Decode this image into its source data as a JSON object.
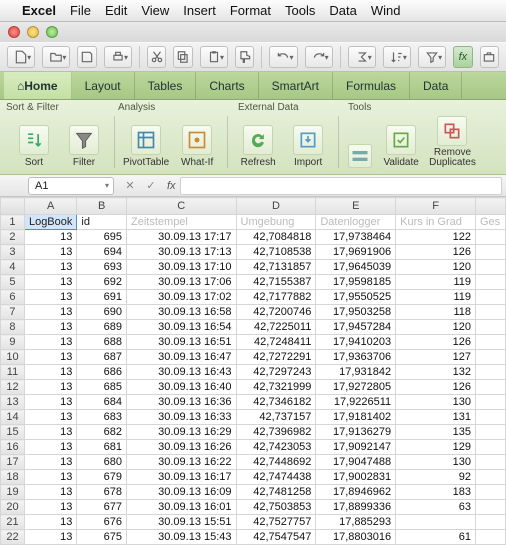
{
  "mac_menu": {
    "apple": "",
    "app": "Excel",
    "items": [
      "File",
      "Edit",
      "View",
      "Insert",
      "Format",
      "Tools",
      "Data",
      "Wind"
    ]
  },
  "tabs": [
    "Home",
    "Layout",
    "Tables",
    "Charts",
    "SmartArt",
    "Formulas",
    "Data"
  ],
  "ribbon_groups": {
    "g1": "Sort & Filter",
    "g2": "Analysis",
    "g3": "External Data",
    "g4": "Tools"
  },
  "ribbon_buttons": {
    "sort": "Sort",
    "filter": "Filter",
    "pivot": "PivotTable",
    "whatif": "What-If",
    "refresh": "Refresh",
    "import": "Import",
    "validate": "Validate",
    "remove": "Remove\nDuplicates"
  },
  "namebox": "A1",
  "fx_label": "fx",
  "columns": [
    "A",
    "B",
    "C",
    "D",
    "E",
    "F"
  ],
  "header_row": {
    "A": "LogBook",
    "B": "id",
    "C": "Zeitstempel",
    "D": "Umgebung",
    "E": "Datenlogger",
    "F": "Kurs in Grad",
    "G": "Ges"
  },
  "rows": [
    {
      "A": "13",
      "B": "695",
      "C": "30.09.13 17:17",
      "D": "42,7084818",
      "E": "17,9738464",
      "F": "122"
    },
    {
      "A": "13",
      "B": "694",
      "C": "30.09.13 17:13",
      "D": "42,7108538",
      "E": "17,9691906",
      "F": "126"
    },
    {
      "A": "13",
      "B": "693",
      "C": "30.09.13 17:10",
      "D": "42,7131857",
      "E": "17,9645039",
      "F": "120"
    },
    {
      "A": "13",
      "B": "692",
      "C": "30.09.13 17:06",
      "D": "42,7155387",
      "E": "17,9598185",
      "F": "119"
    },
    {
      "A": "13",
      "B": "691",
      "C": "30.09.13 17:02",
      "D": "42,7177882",
      "E": "17,9550525",
      "F": "119"
    },
    {
      "A": "13",
      "B": "690",
      "C": "30.09.13 16:58",
      "D": "42,7200746",
      "E": "17,9503258",
      "F": "118"
    },
    {
      "A": "13",
      "B": "689",
      "C": "30.09.13 16:54",
      "D": "42,7225011",
      "E": "17,9457284",
      "F": "120"
    },
    {
      "A": "13",
      "B": "688",
      "C": "30.09.13 16:51",
      "D": "42,7248411",
      "E": "17,9410203",
      "F": "126"
    },
    {
      "A": "13",
      "B": "687",
      "C": "30.09.13 16:47",
      "D": "42,7272291",
      "E": "17,9363706",
      "F": "127"
    },
    {
      "A": "13",
      "B": "686",
      "C": "30.09.13 16:43",
      "D": "42,7297243",
      "E": "17,931842",
      "F": "132"
    },
    {
      "A": "13",
      "B": "685",
      "C": "30.09.13 16:40",
      "D": "42,7321999",
      "E": "17,9272805",
      "F": "126"
    },
    {
      "A": "13",
      "B": "684",
      "C": "30.09.13 16:36",
      "D": "42,7346182",
      "E": "17,9226511",
      "F": "130"
    },
    {
      "A": "13",
      "B": "683",
      "C": "30.09.13 16:33",
      "D": "42,737157",
      "E": "17,9181402",
      "F": "131"
    },
    {
      "A": "13",
      "B": "682",
      "C": "30.09.13 16:29",
      "D": "42,7396982",
      "E": "17,9136279",
      "F": "135"
    },
    {
      "A": "13",
      "B": "681",
      "C": "30.09.13 16:26",
      "D": "42,7423053",
      "E": "17,9092147",
      "F": "129"
    },
    {
      "A": "13",
      "B": "680",
      "C": "30.09.13 16:22",
      "D": "42,7448692",
      "E": "17,9047488",
      "F": "130"
    },
    {
      "A": "13",
      "B": "679",
      "C": "30.09.13 16:17",
      "D": "42,7474438",
      "E": "17,9002831",
      "F": "92"
    },
    {
      "A": "13",
      "B": "678",
      "C": "30.09.13 16:09",
      "D": "42,7481258",
      "E": "17,8946962",
      "F": "183"
    },
    {
      "A": "13",
      "B": "677",
      "C": "30.09.13 16:01",
      "D": "42,7503853",
      "E": "17,8899336",
      "F": "63"
    },
    {
      "A": "13",
      "B": "676",
      "C": "30.09.13 15:51",
      "D": "42,7527757",
      "E": "17,885293",
      "F": ""
    },
    {
      "A": "13",
      "B": "675",
      "C": "30.09.13 15:43",
      "D": "42,7547547",
      "E": "17,8803016",
      "F": "61"
    }
  ]
}
